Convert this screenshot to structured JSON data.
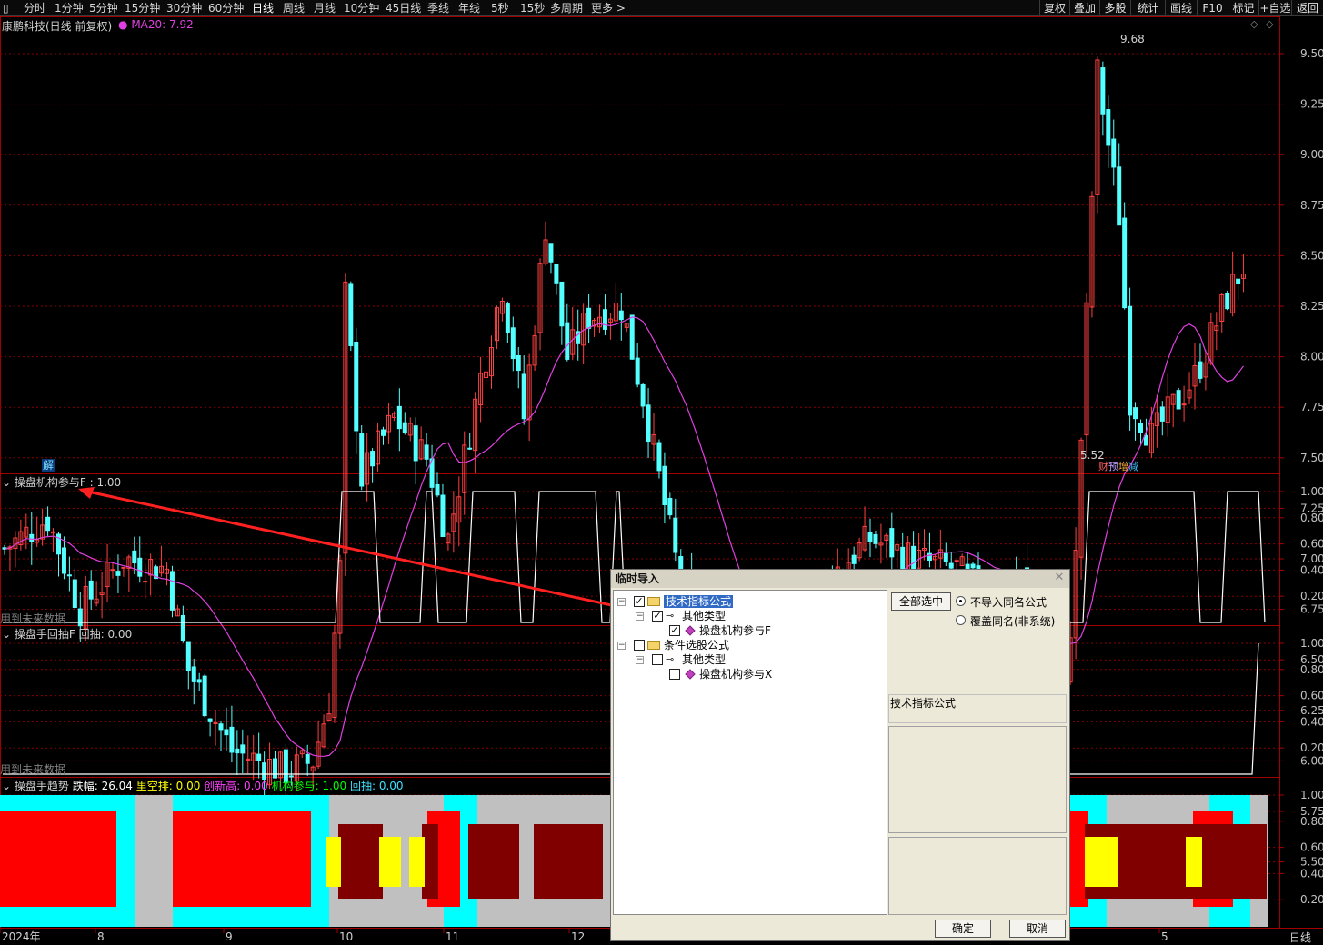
{
  "toolbar": {
    "periods": [
      "分时",
      "1分钟",
      "5分钟",
      "15分钟",
      "30分钟",
      "60分钟",
      "日线",
      "周线",
      "月线",
      "10分钟",
      "45日线",
      "季线",
      "年线",
      "5秒",
      "15秒",
      "多周期",
      "更多"
    ],
    "active_period": "日线",
    "right_buttons": [
      "复权",
      "叠加",
      "多股",
      "统计",
      "画线",
      "F10",
      "标记",
      "+自选",
      "返回"
    ]
  },
  "main_pane": {
    "title": "康鹏科技(日线 前复权)",
    "ma_label": "MA20: 7.92",
    "high_marker": "9.68",
    "low_marker": "5.52",
    "event_badge": "解",
    "news_badges": [
      "财",
      "预",
      "增",
      "减"
    ],
    "price_ticks": [
      "9.50",
      "9.25",
      "9.00",
      "8.75",
      "8.50",
      "8.25",
      "8.00",
      "7.75",
      "7.50",
      "7.25",
      "7.00",
      "6.75",
      "6.50",
      "6.25",
      "6.00",
      "5.75",
      "5.50"
    ]
  },
  "pane1": {
    "title": "操盘机构参与F : 1.00",
    "future_warning": "用到未来数据",
    "ticks": [
      "1.00",
      "0.80",
      "0.60",
      "0.40",
      "0.20"
    ]
  },
  "pane2": {
    "title_name": "操盘手回抽F",
    "title_value": "回抽: 0.00",
    "future_warning": "用到未来数据",
    "ticks": [
      "1.00",
      "0.80",
      "0.60",
      "0.40",
      "0.20"
    ]
  },
  "pane3": {
    "title_name": "操盘手趋势",
    "items": [
      {
        "text": "跌幅: 26.04",
        "color": "#ffffff"
      },
      {
        "text": "里空排: 0.00",
        "color": "#ffff00"
      },
      {
        "text": "创新高: 0.00",
        "color": "#ff40ff"
      },
      {
        "text": "机构参与: 1.00",
        "color": "#00ff00"
      },
      {
        "text": "回抽: 0.00",
        "color": "#40e0ff"
      }
    ],
    "ticks": [
      "1.00",
      "0.80",
      "0.60",
      "0.40",
      "0.20"
    ]
  },
  "x_axis": {
    "labels": [
      "2024年",
      "8",
      "9",
      "10",
      "11",
      "12",
      "5"
    ],
    "period_label": "日线"
  },
  "dialog": {
    "title": "临时导入",
    "tree": {
      "node1": "技术指标公式",
      "node1_child": "其他类型",
      "node1_leaf": "操盘机构参与F",
      "node2": "条件选股公式",
      "node2_child": "其他类型",
      "node2_leaf": "操盘机构参与X"
    },
    "select_all": "全部选中",
    "radio_no_import": "不导入同名公式",
    "radio_overwrite": "覆盖同名(非系统)",
    "info_label": "技术指标公式",
    "ok": "确定",
    "cancel": "取消"
  },
  "colors": {
    "up": "#ff4040",
    "down": "#54ffff",
    "ma": "#e040e0",
    "grid": "#8a0000",
    "axis": "#a00000"
  }
}
